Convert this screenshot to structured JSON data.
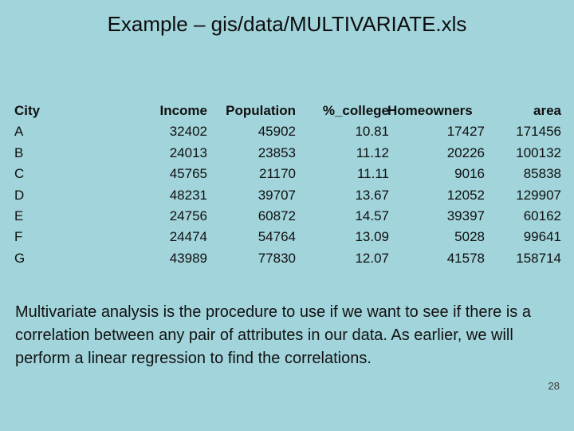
{
  "slide": {
    "title": "Example – gis/data/MULTIVARIATE.xls",
    "page_number": "28",
    "background_color": "#a2d4db",
    "text_color": "#101010"
  },
  "table": {
    "columns": [
      {
        "key": "city",
        "label": "City",
        "align": "left"
      },
      {
        "key": "income",
        "label": "Income",
        "align": "right"
      },
      {
        "key": "population",
        "label": "Population",
        "align": "right"
      },
      {
        "key": "pct_college",
        "label": "%_college",
        "align": "right"
      },
      {
        "key": "homeowners",
        "label": "Homeowners",
        "align": "right"
      },
      {
        "key": "area",
        "label": "area",
        "align": "right"
      }
    ],
    "rows": [
      {
        "city": "A",
        "income": "32402",
        "population": "45902",
        "pct_college": "10.81",
        "homeowners": "17427",
        "area": "171456"
      },
      {
        "city": "B",
        "income": "24013",
        "population": "23853",
        "pct_college": "11.12",
        "homeowners": "20226",
        "area": "100132"
      },
      {
        "city": "C",
        "income": "45765",
        "population": "21170",
        "pct_college": "11.11",
        "homeowners": "9016",
        "area": "85838"
      },
      {
        "city": "D",
        "income": "48231",
        "population": "39707",
        "pct_college": "13.67",
        "homeowners": "12052",
        "area": "129907"
      },
      {
        "city": "E",
        "income": "24756",
        "population": "60872",
        "pct_college": "14.57",
        "homeowners": "39397",
        "area": "60162"
      },
      {
        "city": "F",
        "income": "24474",
        "population": "54764",
        "pct_college": "13.09",
        "homeowners": "5028",
        "area": "99641"
      },
      {
        "city": "G",
        "income": "43989",
        "population": "77830",
        "pct_college": "12.07",
        "homeowners": "41578",
        "area": "158714"
      }
    ]
  },
  "body": {
    "paragraph": "Multivariate analysis is the procedure to use if we want to see if there is a correlation between any pair of attributes in our data. As earlier, we will perform a linear regression to find the correlations."
  }
}
